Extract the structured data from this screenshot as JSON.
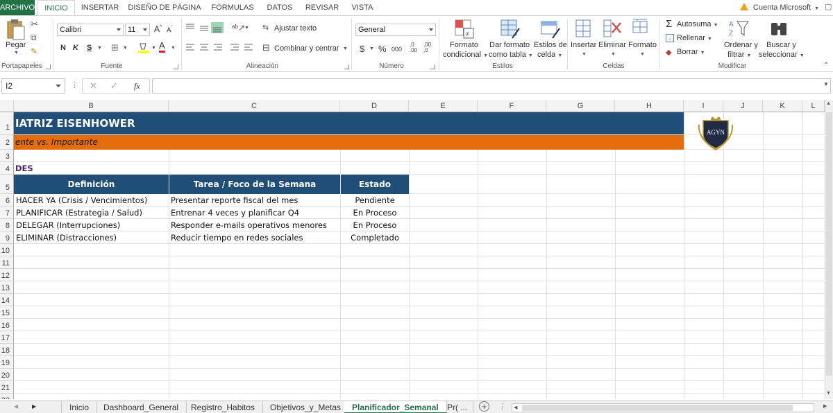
{
  "ribbon_tabs": [
    {
      "label": "ARCHIVO"
    },
    {
      "label": "INICIO"
    },
    {
      "label": "INSERTAR"
    },
    {
      "label": "DISEÑO DE PÁGINA"
    },
    {
      "label": "FÓRMULAS"
    },
    {
      "label": "DATOS"
    },
    {
      "label": "REVISAR"
    },
    {
      "label": "VISTA"
    }
  ],
  "account": "Cuenta Microsoft",
  "ribbon": {
    "clipboard": {
      "paste": "Pegar",
      "label": "Portapapeles"
    },
    "font": {
      "name": "Calibri",
      "size": "11",
      "bold": "N",
      "italic": "K",
      "underline": "S",
      "label": "Fuente"
    },
    "alignment": {
      "wrap": "Ajustar texto",
      "merge": "Combinar y centrar",
      "label": "Alineación"
    },
    "number": {
      "format": "General",
      "currency": "$",
      "percent": "%",
      "thousands": "000",
      "inc": ",0 .00",
      "dec": ",00 ,0",
      "label": "Número"
    },
    "styles": {
      "cond_format_1": "Formato",
      "cond_format_2": "condicional",
      "table_1": "Dar formato",
      "table_2": "como tabla",
      "cell_styles_1": "Estilos de",
      "cell_styles_2": "celda",
      "label": "Estilos"
    },
    "cells": {
      "insert": "Insertar",
      "delete": "Eliminar",
      "format": "Formato",
      "label": "Celdas"
    },
    "editing": {
      "autosum": "Autosuma",
      "fill": "Rellenar",
      "clear": "Borrar",
      "sort_1": "Ordenar y",
      "sort_2": "filtrar",
      "find_1": "Buscar y",
      "find_2": "seleccionar",
      "label": "Modificar"
    }
  },
  "formula_bar": {
    "cell_ref": "I2",
    "fx": "fx",
    "content": ""
  },
  "columns": [
    "B",
    "C",
    "D",
    "E",
    "F",
    "G",
    "H",
    "I",
    "J",
    "K",
    "L"
  ],
  "rows": [
    "1",
    "2",
    "3",
    "4",
    "5",
    "6",
    "7",
    "8",
    "9",
    "10",
    "11",
    "12",
    "13",
    "14",
    "15",
    "16",
    "17",
    "18",
    "19",
    "20",
    "21",
    "22"
  ],
  "sheet": {
    "title": "IATRIZ EISENHOWER",
    "subtitle": "ente vs. Importante",
    "section": "DES",
    "logo_text": "AGYN",
    "table_headers": [
      "Definición",
      "Tarea / Foco de la Semana",
      "Estado"
    ],
    "table_rows": [
      {
        "definicion": "HACER YA (Crisis / Vencimientos)",
        "tarea": "Presentar reporte fiscal del mes",
        "estado": "Pendiente"
      },
      {
        "definicion": "PLANIFICAR (Estrategia / Salud)",
        "tarea": "Entrenar 4 veces y planificar Q4",
        "estado": "En Proceso"
      },
      {
        "definicion": "DELEGAR (Interrupciones)",
        "tarea": "Responder e-mails operativos menores",
        "estado": "En Proceso"
      },
      {
        "definicion": "ELIMINAR (Distracciones)",
        "tarea": "Reducir tiempo en redes sociales",
        "estado": "Completado"
      }
    ]
  },
  "sheet_tabs": [
    {
      "label": "Inicio"
    },
    {
      "label": "Dashboard_General"
    },
    {
      "label": "Registro_Habitos"
    },
    {
      "label": "Objetivos_y_Metas"
    },
    {
      "label": "Planificador_Semanal"
    },
    {
      "label": "Pr( ..."
    }
  ],
  "colors": {
    "excel_green": "#217346",
    "title_blue": "#1f4e79",
    "subtitle_orange": "#e46c0a"
  }
}
